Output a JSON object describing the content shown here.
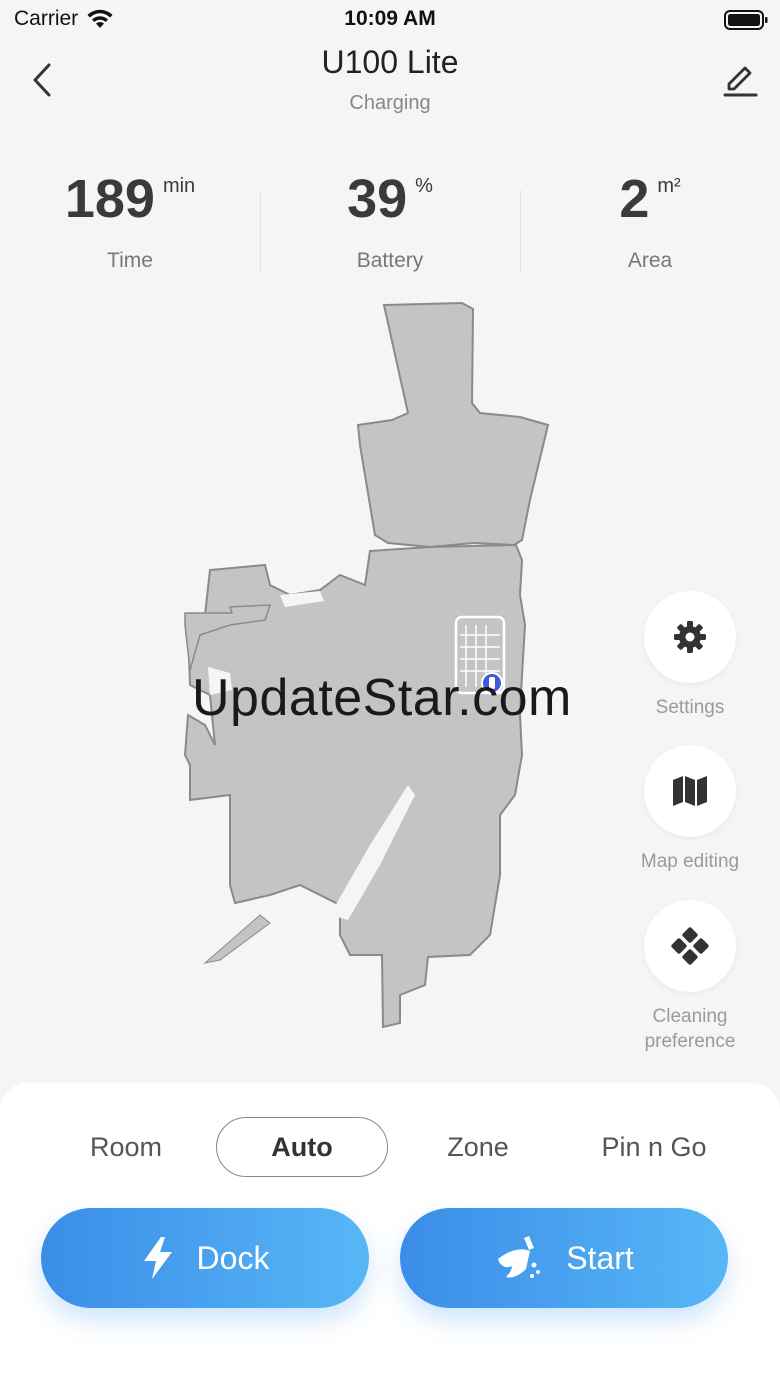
{
  "status_bar": {
    "carrier": "Carrier",
    "time": "10:09 AM"
  },
  "header": {
    "title": "U100 Lite",
    "subtitle": "Charging"
  },
  "stats": [
    {
      "value": "189",
      "unit": "min",
      "label": "Time"
    },
    {
      "value": "39",
      "unit": "%",
      "label": "Battery"
    },
    {
      "value": "2",
      "unit": "m²",
      "label": "Area"
    }
  ],
  "watermark": "UpdateStar.com",
  "side_controls": [
    {
      "label": "Settings",
      "icon": "gear-icon"
    },
    {
      "label": "Map editing",
      "icon": "map-icon"
    },
    {
      "label_line1": "Cleaning",
      "label_line2": "preference",
      "icon": "diamond-dots-icon"
    }
  ],
  "modes": [
    "Room",
    "Auto",
    "Zone",
    "Pin n Go"
  ],
  "active_mode": "Auto",
  "actions": {
    "dock_label": "Dock",
    "start_label": "Start"
  },
  "colors": {
    "accent_start": "#3b8de8",
    "accent_end": "#57b7f6",
    "map_fill": "#c4c4c4",
    "robot": "#3d5bd6"
  }
}
